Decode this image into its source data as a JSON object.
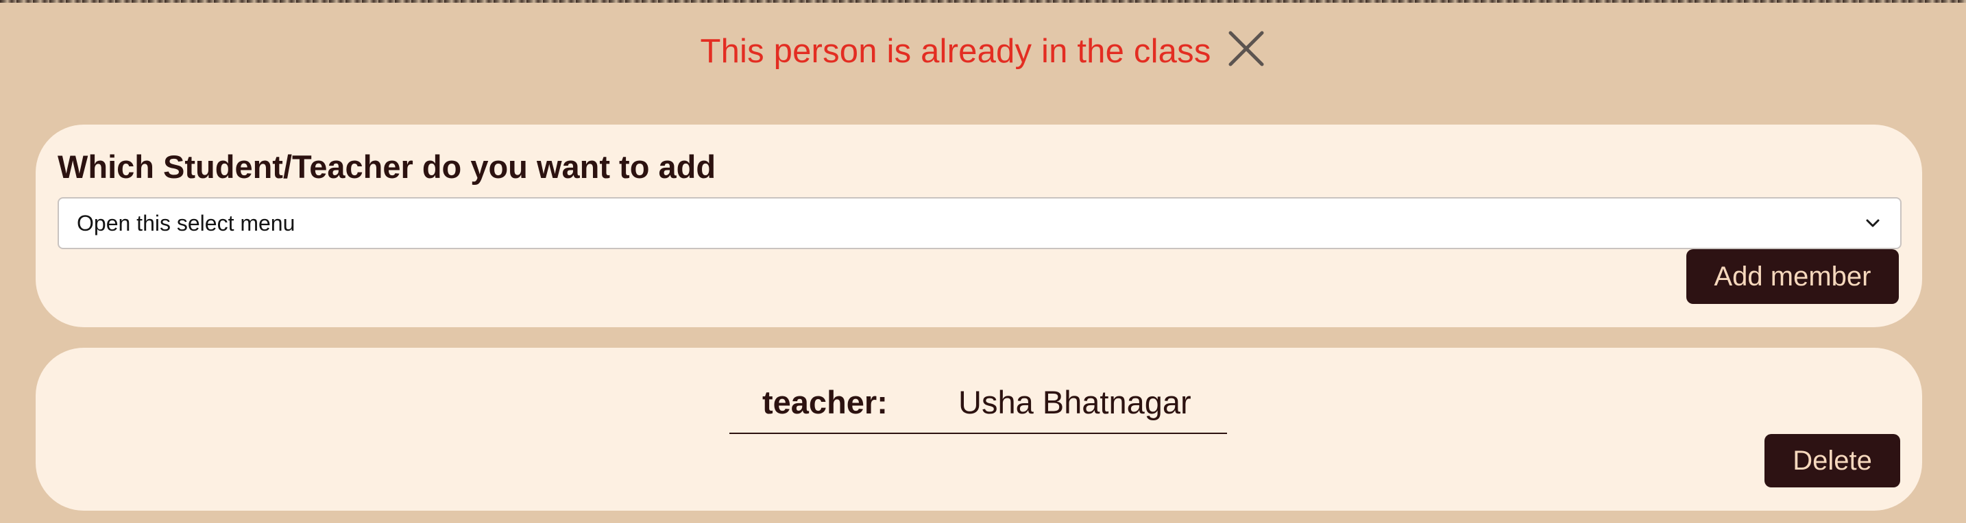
{
  "alert": {
    "message": "This person is already in the class",
    "color": "#e32d22",
    "close_icon": "close-icon"
  },
  "add_member": {
    "title": "Which Student/Teacher do you want to add",
    "select": {
      "value": "Open this select menu",
      "icon": "chevron-down-icon"
    },
    "button_label": "Add member"
  },
  "members": [
    {
      "role": "teacher:",
      "name": "Usha Bhatnagar",
      "delete_label": "Delete"
    }
  ],
  "colors": {
    "page_background": "#e2c7a9",
    "card_background": "#fdf0e2",
    "button_background": "#2d1213",
    "button_text": "#f6d8bd",
    "text": "#2c1210"
  }
}
